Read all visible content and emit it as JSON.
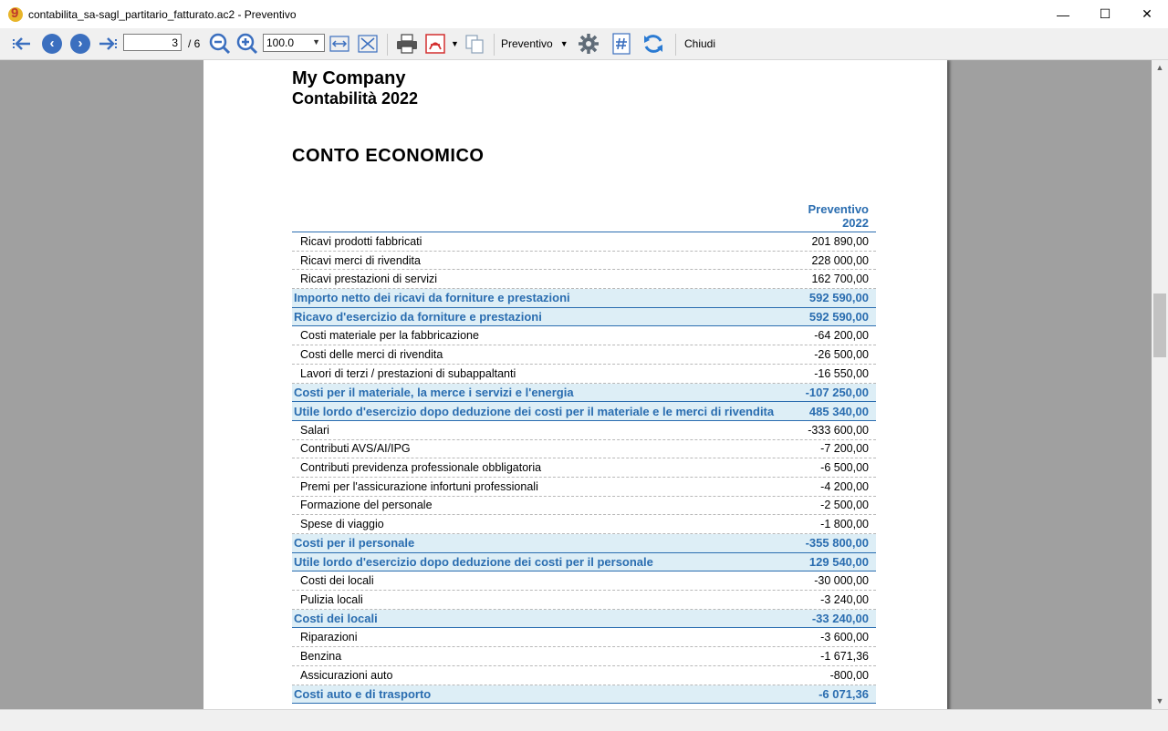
{
  "window": {
    "title": "contabilita_sa-sagl_partitario_fatturato.ac2 - Preventivo",
    "minimize": "—",
    "maximize": "☐",
    "close": "✕"
  },
  "toolbar": {
    "page_current": "3",
    "page_total": "/ 6",
    "zoom_value": "100.0",
    "view_select": "Preventivo",
    "close_label": "Chiudi"
  },
  "report": {
    "company": "My Company",
    "subtitle": "Contabilità 2022",
    "title": "CONTO ECONOMICO",
    "column_header_1": "Preventivo",
    "column_header_2": "2022",
    "rows": [
      {
        "label": "Ricavi prodotti fabbricati",
        "value": "201 890,00",
        "total": false
      },
      {
        "label": "Ricavi merci di rivendita",
        "value": "228 000,00",
        "total": false
      },
      {
        "label": "Ricavi prestazioni di servizi",
        "value": "162 700,00",
        "total": false
      },
      {
        "label": "Importo netto dei ricavi da forniture e prestazioni",
        "value": "592 590,00",
        "total": true
      },
      {
        "label": "Ricavo d'esercizio da forniture e prestazioni",
        "value": "592 590,00",
        "total": true
      },
      {
        "label": "Costi materiale per la fabbricazione",
        "value": "-64 200,00",
        "total": false
      },
      {
        "label": "Costi delle merci di rivendita",
        "value": "-26 500,00",
        "total": false
      },
      {
        "label": "Lavori di terzi / prestazioni di subappaltanti",
        "value": "-16 550,00",
        "total": false
      },
      {
        "label": "Costi per il materiale, la merce i servizi e l'energia",
        "value": "-107 250,00",
        "total": true
      },
      {
        "label": "Utile lordo d'esercizio dopo deduzione dei costi per il materiale e le merci di rivendita",
        "value": "485 340,00",
        "total": true
      },
      {
        "label": "Salari",
        "value": "-333 600,00",
        "total": false
      },
      {
        "label": "Contributi AVS/AI/IPG",
        "value": "-7 200,00",
        "total": false
      },
      {
        "label": "Contributi previdenza professionale obbligatoria",
        "value": "-6 500,00",
        "total": false
      },
      {
        "label": "Premi per l'assicurazione infortuni professionali",
        "value": "-4 200,00",
        "total": false
      },
      {
        "label": "Formazione del personale",
        "value": "-2 500,00",
        "total": false
      },
      {
        "label": "Spese di viaggio",
        "value": "-1 800,00",
        "total": false
      },
      {
        "label": "Costi per il personale",
        "value": "-355 800,00",
        "total": true
      },
      {
        "label": "Utile lordo d'esercizio dopo deduzione dei costi per il personale",
        "value": "129 540,00",
        "total": true
      },
      {
        "label": "Costi dei locali",
        "value": "-30 000,00",
        "total": false
      },
      {
        "label": "Pulizia locali",
        "value": "-3 240,00",
        "total": false
      },
      {
        "label": "Costi dei locali",
        "value": "-33 240,00",
        "total": true
      },
      {
        "label": "Riparazioni",
        "value": "-3 600,00",
        "total": false
      },
      {
        "label": "Benzina",
        "value": "-1 671,36",
        "total": false
      },
      {
        "label": "Assicurazioni auto",
        "value": "-800,00",
        "total": false
      },
      {
        "label": "Costi auto e di trasporto",
        "value": "-6 071,36",
        "total": true
      }
    ]
  },
  "colors": {
    "accent_blue": "#2a6db0",
    "total_row_bg": "#ddeef6",
    "nav_blue": "#3b6fbf",
    "pdf_red": "#d32f2f"
  }
}
